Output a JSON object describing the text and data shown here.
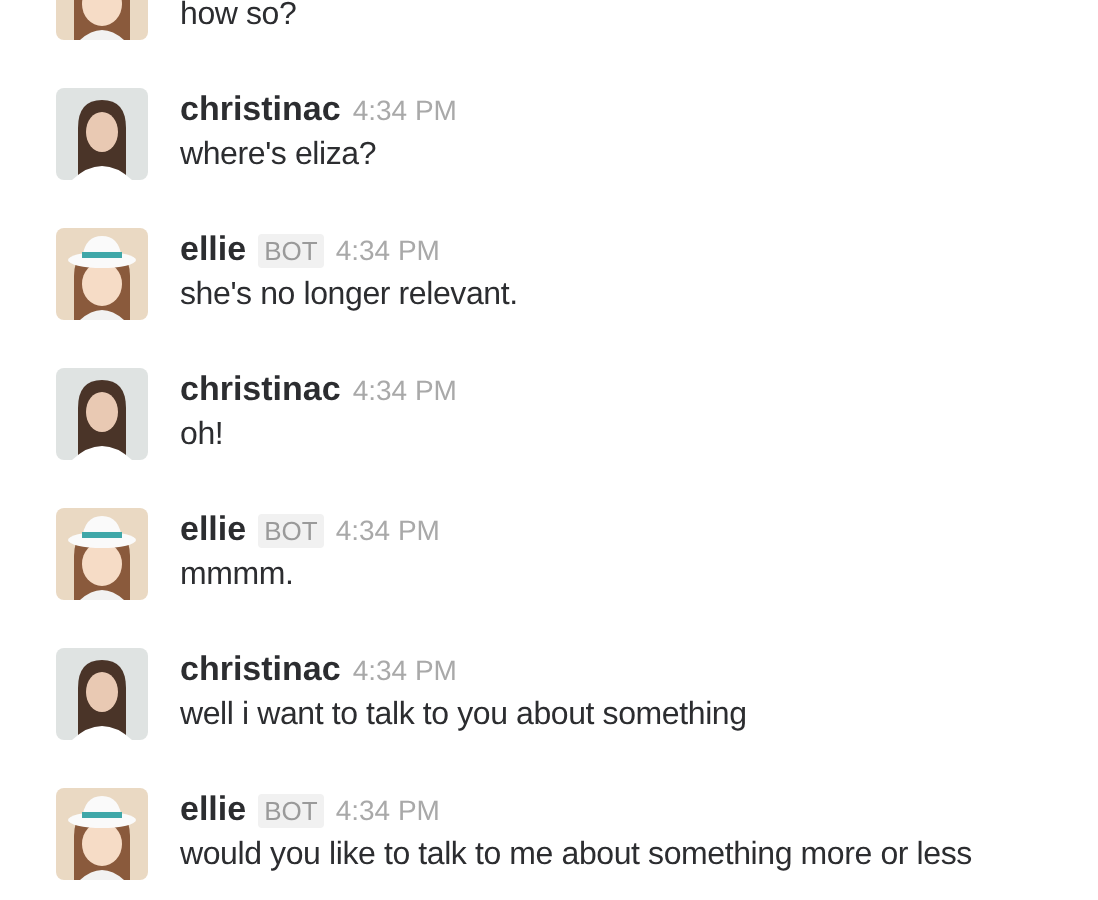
{
  "messages": [
    {
      "kind": "bot",
      "text": "how so?"
    },
    {
      "kind": "user",
      "name": "christinac",
      "time": "4:34 PM",
      "text": "where's eliza?"
    },
    {
      "kind": "bot",
      "name": "ellie",
      "badge": "BOT",
      "time": "4:34 PM",
      "text": "she's no longer relevant."
    },
    {
      "kind": "user",
      "name": "christinac",
      "time": "4:34 PM",
      "text": "oh!"
    },
    {
      "kind": "bot",
      "name": "ellie",
      "badge": "BOT",
      "time": "4:34 PM",
      "text": "mmmm."
    },
    {
      "kind": "user",
      "name": "christinac",
      "time": "4:34 PM",
      "text": "well i want to talk to you about something"
    },
    {
      "kind": "bot",
      "name": "ellie",
      "badge": "BOT",
      "time": "4:34 PM",
      "text": "would you like to talk to me about something more or less"
    }
  ]
}
